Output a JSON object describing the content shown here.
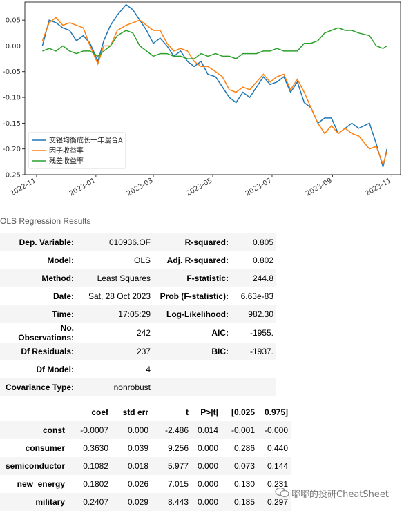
{
  "chart_data": {
    "type": "line",
    "title": "",
    "xlabel": "",
    "ylabel": "",
    "ylim": [
      -0.25,
      0.085
    ],
    "yticks": [
      "0.05",
      "0.00",
      "-0.05",
      "-0.10",
      "-0.15",
      "-0.20",
      "-0.25"
    ],
    "ytick_values": [
      0.05,
      0.0,
      -0.05,
      -0.1,
      -0.15,
      -0.2,
      -0.25
    ],
    "xticks": [
      "2022-11",
      "2023-01",
      "2023-03",
      "2023-05",
      "2023-07",
      "2023-09",
      "2023-11"
    ],
    "xtick_values": [
      "2022-11-01",
      "2023-01-01",
      "2023-03-01",
      "2023-05-01",
      "2023-07-01",
      "2023-09-01",
      "2023-11-01"
    ],
    "legend_position": "lower-left",
    "series": [
      {
        "name": "交银均衡成长一年混合A",
        "color": "#1f77b4",
        "x": [
          "2022-11-07",
          "2022-11-14",
          "2022-11-21",
          "2022-11-28",
          "2022-12-05",
          "2022-12-12",
          "2022-12-19",
          "2022-12-26",
          "2023-01-03",
          "2023-01-09",
          "2023-01-16",
          "2023-01-23",
          "2023-02-01",
          "2023-02-08",
          "2023-02-15",
          "2023-02-22",
          "2023-03-01",
          "2023-03-08",
          "2023-03-15",
          "2023-03-22",
          "2023-03-29",
          "2023-04-05",
          "2023-04-12",
          "2023-04-19",
          "2023-04-26",
          "2023-05-04",
          "2023-05-11",
          "2023-05-18",
          "2023-05-25",
          "2023-06-01",
          "2023-06-08",
          "2023-06-15",
          "2023-06-22",
          "2023-06-29",
          "2023-07-06",
          "2023-07-13",
          "2023-07-20",
          "2023-07-27",
          "2023-08-03",
          "2023-08-10",
          "2023-08-17",
          "2023-08-24",
          "2023-08-31",
          "2023-09-07",
          "2023-09-14",
          "2023-09-21",
          "2023-09-28",
          "2023-10-09",
          "2023-10-16",
          "2023-10-23",
          "2023-10-27"
        ],
        "values": [
          0.0,
          0.05,
          0.045,
          0.035,
          0.03,
          0.01,
          0.02,
          0.005,
          -0.03,
          0.01,
          0.04,
          0.06,
          0.08,
          0.07,
          0.05,
          0.03,
          0.005,
          0.015,
          0.0,
          -0.02,
          -0.01,
          -0.03,
          -0.04,
          -0.03,
          -0.055,
          -0.06,
          -0.08,
          -0.1,
          -0.11,
          -0.09,
          -0.1,
          -0.08,
          -0.06,
          -0.075,
          -0.07,
          -0.06,
          -0.09,
          -0.07,
          -0.11,
          -0.12,
          -0.15,
          -0.14,
          -0.14,
          -0.17,
          -0.16,
          -0.15,
          -0.16,
          -0.15,
          -0.19,
          -0.235,
          -0.2
        ]
      },
      {
        "name": "因子收益率",
        "color": "#ff7f0e",
        "x": [
          "2022-11-07",
          "2022-11-14",
          "2022-11-21",
          "2022-11-28",
          "2022-12-05",
          "2022-12-12",
          "2022-12-19",
          "2022-12-26",
          "2023-01-03",
          "2023-01-09",
          "2023-01-16",
          "2023-01-23",
          "2023-02-01",
          "2023-02-08",
          "2023-02-15",
          "2023-02-22",
          "2023-03-01",
          "2023-03-08",
          "2023-03-15",
          "2023-03-22",
          "2023-03-29",
          "2023-04-05",
          "2023-04-12",
          "2023-04-19",
          "2023-04-26",
          "2023-05-04",
          "2023-05-11",
          "2023-05-18",
          "2023-05-25",
          "2023-06-01",
          "2023-06-08",
          "2023-06-15",
          "2023-06-22",
          "2023-06-29",
          "2023-07-06",
          "2023-07-13",
          "2023-07-20",
          "2023-07-27",
          "2023-08-03",
          "2023-08-10",
          "2023-08-17",
          "2023-08-24",
          "2023-08-31",
          "2023-09-07",
          "2023-09-14",
          "2023-09-21",
          "2023-09-28",
          "2023-10-09",
          "2023-10-16",
          "2023-10-23",
          "2023-10-27"
        ],
        "values": [
          0.01,
          0.045,
          0.055,
          0.04,
          0.045,
          0.04,
          0.035,
          0.0,
          -0.035,
          0.0,
          0.0,
          0.03,
          0.04,
          0.045,
          0.05,
          0.04,
          0.03,
          0.03,
          0.005,
          -0.01,
          -0.005,
          -0.01,
          -0.03,
          -0.04,
          -0.04,
          -0.05,
          -0.06,
          -0.085,
          -0.09,
          -0.08,
          -0.085,
          -0.07,
          -0.055,
          -0.07,
          -0.06,
          -0.055,
          -0.085,
          -0.065,
          -0.09,
          -0.12,
          -0.15,
          -0.17,
          -0.155,
          -0.17,
          -0.16,
          -0.17,
          -0.175,
          -0.2,
          -0.195,
          -0.23,
          -0.205
        ]
      },
      {
        "name": "残差收益率",
        "color": "#2ca02c",
        "x": [
          "2022-11-07",
          "2022-11-14",
          "2022-11-21",
          "2022-11-28",
          "2022-12-05",
          "2022-12-12",
          "2022-12-19",
          "2022-12-26",
          "2023-01-03",
          "2023-01-09",
          "2023-01-16",
          "2023-01-23",
          "2023-02-01",
          "2023-02-08",
          "2023-02-15",
          "2023-02-22",
          "2023-03-01",
          "2023-03-08",
          "2023-03-15",
          "2023-03-22",
          "2023-03-29",
          "2023-04-05",
          "2023-04-12",
          "2023-04-19",
          "2023-04-26",
          "2023-05-04",
          "2023-05-11",
          "2023-05-18",
          "2023-05-25",
          "2023-06-01",
          "2023-06-08",
          "2023-06-15",
          "2023-06-22",
          "2023-06-29",
          "2023-07-06",
          "2023-07-13",
          "2023-07-20",
          "2023-07-27",
          "2023-08-03",
          "2023-08-10",
          "2023-08-17",
          "2023-08-24",
          "2023-08-31",
          "2023-09-07",
          "2023-09-14",
          "2023-09-21",
          "2023-09-28",
          "2023-10-09",
          "2023-10-16",
          "2023-10-23",
          "2023-10-27"
        ],
        "values": [
          -0.01,
          -0.005,
          -0.01,
          0.0,
          -0.01,
          -0.015,
          -0.01,
          -0.01,
          -0.02,
          -0.01,
          0.0,
          0.02,
          0.03,
          0.025,
          0.0,
          -0.01,
          -0.02,
          -0.015,
          -0.015,
          -0.02,
          -0.02,
          -0.025,
          -0.025,
          -0.015,
          -0.02,
          -0.015,
          -0.02,
          -0.02,
          -0.025,
          -0.015,
          -0.015,
          -0.015,
          -0.01,
          -0.01,
          -0.005,
          -0.01,
          -0.01,
          -0.01,
          0.005,
          0.005,
          0.01,
          0.025,
          0.03,
          0.035,
          0.03,
          0.03,
          0.025,
          0.02,
          0.0,
          -0.005,
          0.0
        ]
      }
    ]
  },
  "ols": {
    "caption": "OLS Regression Results",
    "summary_rows": [
      {
        "l1": "Dep. Variable:",
        "v1": "010936.OF",
        "l2": "R-squared:",
        "v2": "0.805"
      },
      {
        "l1": "Model:",
        "v1": "OLS",
        "l2": "Adj. R-squared:",
        "v2": "0.802"
      },
      {
        "l1": "Method:",
        "v1": "Least Squares",
        "l2": "F-statistic:",
        "v2": "244.8"
      },
      {
        "l1": "Date:",
        "v1": "Sat, 28 Oct 2023",
        "l2": "Prob (F-statistic):",
        "v2": "6.63e-83"
      },
      {
        "l1": "Time:",
        "v1": "17:05:29",
        "l2": "Log-Likelihood:",
        "v2": "982.30"
      },
      {
        "l1": "No. Observations:",
        "v1": "242",
        "l2": "AIC:",
        "v2": "-1955."
      },
      {
        "l1": "Df Residuals:",
        "v1": "237",
        "l2": "BIC:",
        "v2": "-1937."
      },
      {
        "l1": "Df Model:",
        "v1": "4",
        "l2": "",
        "v2": ""
      },
      {
        "l1": "Covariance Type:",
        "v1": "nonrobust",
        "l2": "",
        "v2": ""
      }
    ],
    "coef_headers": [
      "",
      "coef",
      "std err",
      "t",
      "P>|t|",
      "[0.025",
      "0.975]"
    ],
    "coef_rows": [
      [
        "const",
        "-0.0007",
        "0.000",
        "-2.486",
        "0.014",
        "-0.001",
        "-0.000"
      ],
      [
        "consumer",
        "0.3630",
        "0.039",
        "9.256",
        "0.000",
        "0.286",
        "0.440"
      ],
      [
        "semiconductor",
        "0.1082",
        "0.018",
        "5.977",
        "0.000",
        "0.073",
        "0.144"
      ],
      [
        "new_energy",
        "0.1802",
        "0.026",
        "7.015",
        "0.000",
        "0.130",
        "0.231"
      ],
      [
        "military",
        "0.2407",
        "0.029",
        "8.443",
        "0.000",
        "0.185",
        "0.297"
      ]
    ]
  },
  "watermark": {
    "icon": "wechat-icon",
    "text": "嘟嘟的投研CheatSheet"
  }
}
